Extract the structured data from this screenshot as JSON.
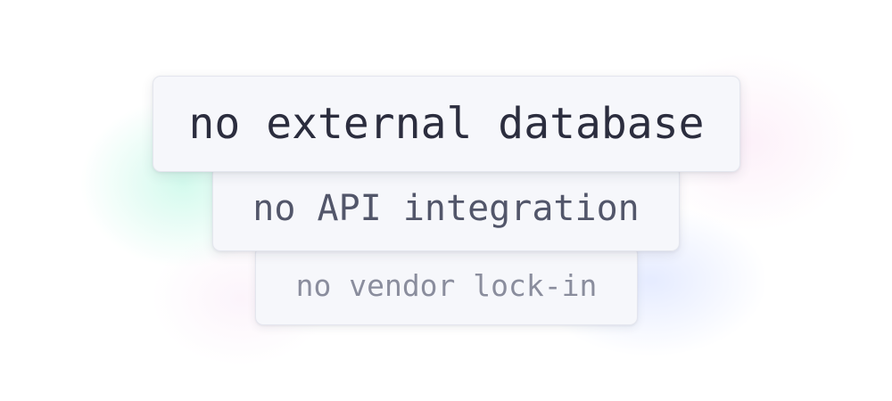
{
  "phrases": [
    {
      "text": "no external database",
      "color": "#2b2d3e"
    },
    {
      "text": "no API integration",
      "color": "#52566a"
    },
    {
      "text": "no vendor lock-in",
      "color": "#8a8d9d"
    }
  ],
  "colors": {
    "background": "#ffffff",
    "chip_fill": "#f6f7fb",
    "chip_border": "#e4e6ee"
  }
}
